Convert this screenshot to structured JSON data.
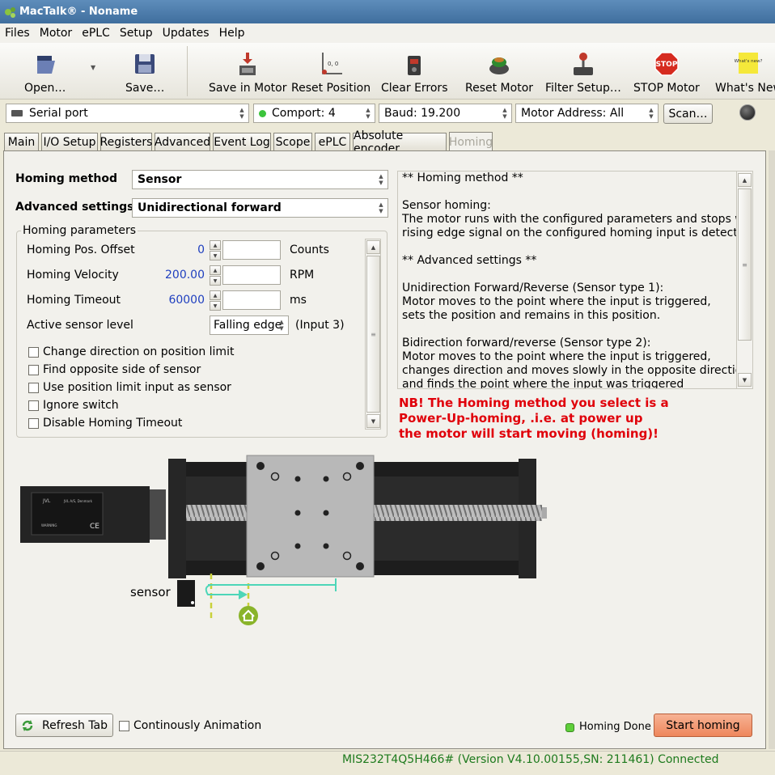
{
  "window": {
    "title": "MacTalk® - Noname"
  },
  "menu": [
    "Files",
    "Motor",
    "ePLC",
    "Setup",
    "Updates",
    "Help"
  ],
  "toolbar": {
    "open": "Open…",
    "save": "Save…",
    "save_in_motor": "Save in Motor",
    "reset_position": "Reset Position",
    "clear_errors": "Clear Errors",
    "reset_motor": "Reset Motor",
    "filter_setup": "Filter Setup…",
    "stop_motor": "STOP Motor",
    "whats_new": "What's New",
    "stop_icon_text": "STOP",
    "whats_new_icon_text": "What's new?"
  },
  "connection": {
    "port": "Serial port",
    "comport": "Comport: 4",
    "baud": "Baud: 19.200",
    "address": "Motor Address: All",
    "scan": "Scan…"
  },
  "tabs": [
    "Main",
    "I/O Setup",
    "Registers",
    "Advanced",
    "Event Log",
    "Scope",
    "ePLC",
    "Absolute encoder",
    "Homing"
  ],
  "active_tab": "Homing",
  "homing": {
    "method_label": "Homing method",
    "method_value": "Sensor",
    "advanced_label": "Advanced settings",
    "advanced_value": "Unidirectional forward",
    "params_title": "Homing parameters",
    "params": [
      {
        "label": "Homing Pos. Offset",
        "value": "0",
        "unit": "Counts"
      },
      {
        "label": "Homing Velocity",
        "value": "200.00",
        "unit": "RPM"
      },
      {
        "label": "Homing Timeout",
        "value": "60000",
        "unit": "ms"
      }
    ],
    "sensor_level_label": "Active sensor level",
    "sensor_level_value": "Falling edge",
    "sensor_input": "(Input 3)",
    "checkboxes": [
      "Change direction on position limit",
      "Find opposite side of sensor",
      "Use position limit input as sensor",
      "Ignore switch",
      "Disable Homing Timeout"
    ],
    "info_text": "** Homing method **\n\nSensor homing:\nThe motor runs with the configured parameters and stops when a\nrising edge signal on the configured homing input is detected.\n\n** Advanced settings **\n\nUnidirection Forward/Reverse (Sensor type 1):\nMotor moves to the point where the input is triggered,\nsets the position and remains in this position.\n\nBidirection forward/reverse (Sensor type 2):\nMotor moves to the point where the input is triggered,\nchanges direction and moves slowly in the opposite direction\nand finds the point where the input was triggered",
    "warning": "NB! The Homing method you select is a\nPower-Up-homing, .i.e. at power up\nthe motor will start moving (homing)!",
    "sensor_label": "sensor",
    "refresh": "Refresh Tab",
    "animation": "Continously Animation",
    "status": "Homing Done",
    "start": "Start homing",
    "motor_label": {
      "brand": "JVL",
      "model": "JVL A/S, Denmark",
      "warning": "WARNING",
      "ce": "CE"
    }
  },
  "statusbar": {
    "text": "MIS232T4Q5H466# (Version V4.10.00155,SN: 211461) Connected"
  },
  "colors": {
    "accent": "#1d7a1d",
    "warning": "#e0000a",
    "start_button": "#f0916a",
    "home_marker": "#8ab42a",
    "trajectory": "#4dd6b8"
  }
}
